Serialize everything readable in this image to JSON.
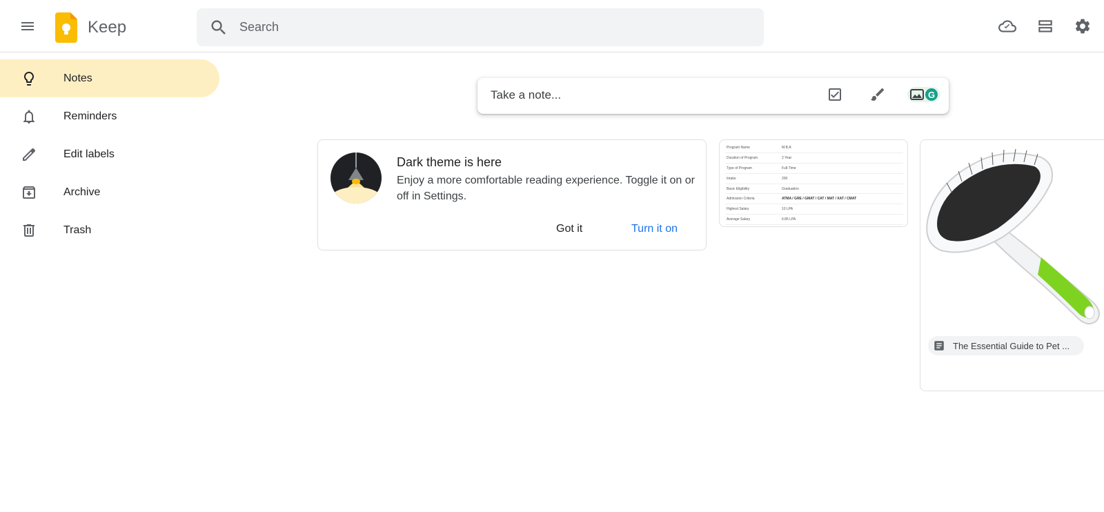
{
  "header": {
    "app_title": "Keep",
    "search_placeholder": "Search",
    "icons": [
      "menu-icon",
      "keep-logo",
      "search-icon",
      "cloud-sync-icon",
      "list-view-icon",
      "settings-icon"
    ]
  },
  "sidebar": {
    "items": [
      {
        "label": "Notes",
        "icon": "lightbulb-icon",
        "active": true
      },
      {
        "label": "Reminders",
        "icon": "bell-icon",
        "active": false
      },
      {
        "label": "Edit labels",
        "icon": "pencil-icon",
        "active": false
      },
      {
        "label": "Archive",
        "icon": "archive-icon",
        "active": false
      },
      {
        "label": "Trash",
        "icon": "trash-icon",
        "active": false
      }
    ]
  },
  "take_note": {
    "placeholder": "Take a note...",
    "icons": [
      "checkbox-icon",
      "brush-icon",
      "image-icon"
    ]
  },
  "promo": {
    "title": "Dark theme is here",
    "text": "Enjoy a more comfortable reading experience. Toggle it on or off in Settings.",
    "dismiss_label": "Got it",
    "action_label": "Turn it on"
  },
  "table_note": {
    "rows": [
      [
        "Program Name",
        "M.B.A"
      ],
      [
        "Duration of Program",
        "2 Year"
      ],
      [
        "Type of Program",
        "Full-Time"
      ],
      [
        "Intake",
        "200"
      ],
      [
        "Basic Eligibility",
        "Graduation"
      ],
      [
        "Admission Criteria",
        "ATMA / GRE / GMAT / CAT / MAT / XAT / CMAT"
      ],
      [
        "Highest Salary",
        "10 LPA"
      ],
      [
        "Average Salary",
        "6.85 LPA"
      ]
    ]
  },
  "image_note": {
    "link_title": "The Essential Guide to Pet ..."
  },
  "colors": {
    "active_nav": "#feefc3",
    "keep_yellow": "#fbbc04",
    "link_blue": "#1a73e8",
    "brush_green": "#7ed321"
  }
}
